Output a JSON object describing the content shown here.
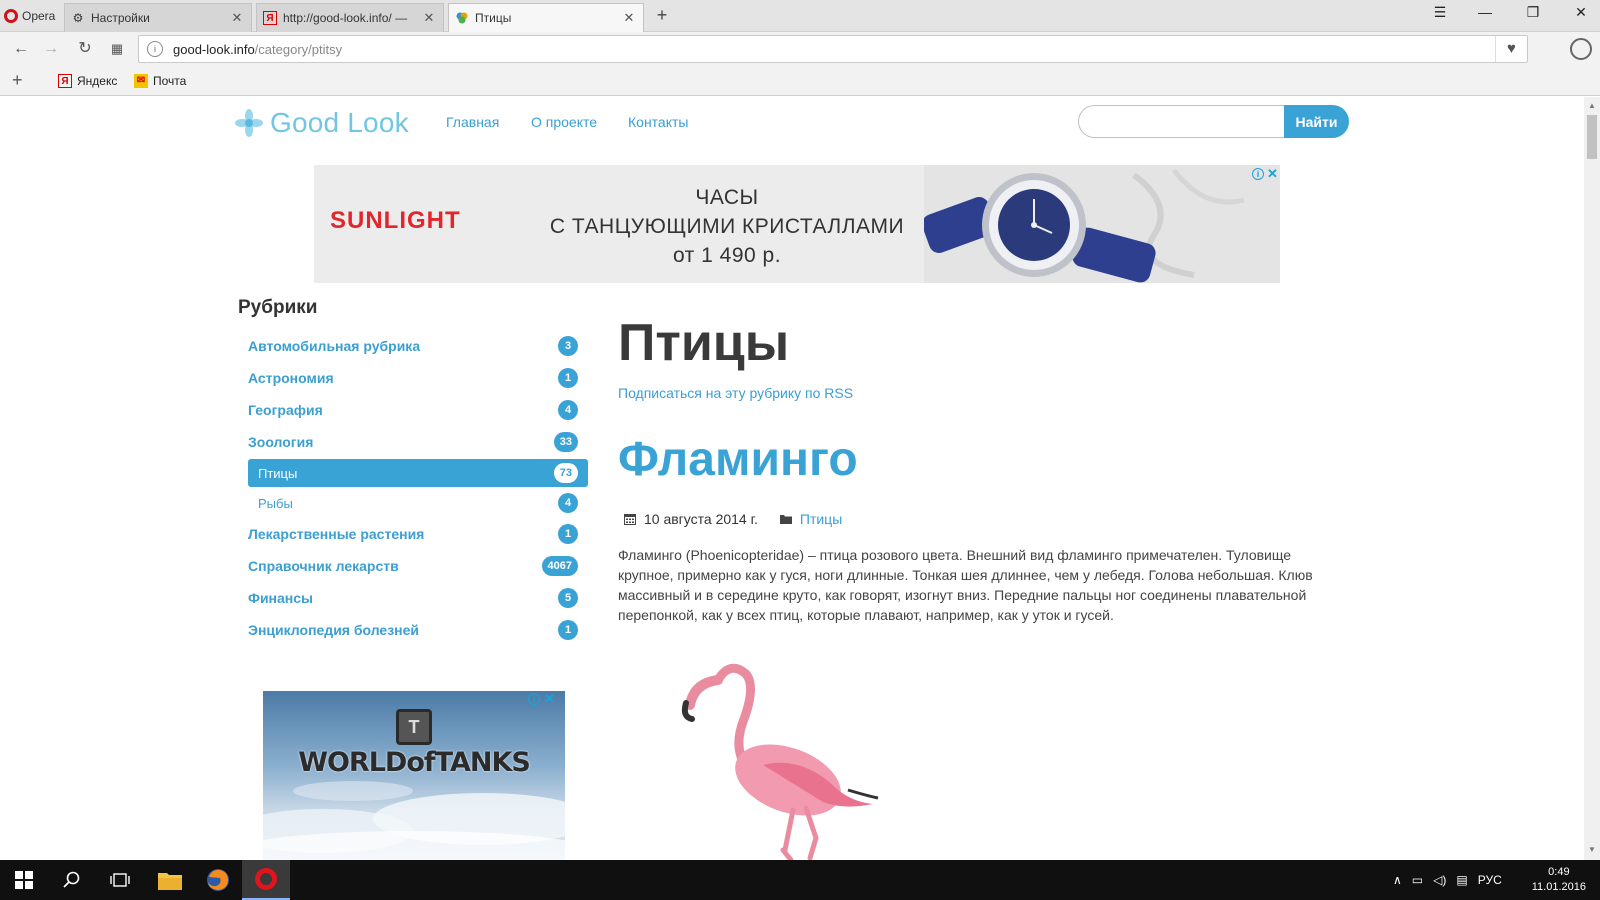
{
  "browser": {
    "menu_label": "Opera",
    "tabs": [
      {
        "label": "Настройки",
        "icon": "gear-icon"
      },
      {
        "label": "http://good-look.info/ — ",
        "icon": "yandex-icon"
      },
      {
        "label": "Птицы",
        "icon": "site-favicon"
      }
    ],
    "address": {
      "host": "good-look.info",
      "path": "/category/ptitsy"
    },
    "bookmarks": [
      {
        "label": "Яндекс",
        "icon": "yandex-icon"
      },
      {
        "label": "Почта",
        "icon": "mail-icon"
      }
    ]
  },
  "site": {
    "logo_text": "Good Look",
    "nav": [
      "Главная",
      "О проекте",
      "Контакты"
    ],
    "search": {
      "placeholder": "",
      "button": "Найти"
    }
  },
  "banner": {
    "brand": "SUNLIGHT",
    "line1": "ЧАСЫ",
    "line2": "С ТАНЦУЮЩИМИ КРИСТАЛЛАМИ",
    "line3": "от 1 490 р."
  },
  "sidebar": {
    "title": "Рубрики",
    "categories": [
      {
        "label": "Автомобильная рубрика",
        "count": "3"
      },
      {
        "label": "Астрономия",
        "count": "1"
      },
      {
        "label": "География",
        "count": "4"
      },
      {
        "label": "Зоология",
        "count": "33"
      },
      {
        "label": "Птицы",
        "count": "73"
      },
      {
        "label": "Рыбы",
        "count": "4"
      },
      {
        "label": "Лекарственные растения",
        "count": "1"
      },
      {
        "label": "Справочник лекарств",
        "count": "4067"
      },
      {
        "label": "Финансы",
        "count": "5"
      },
      {
        "label": "Энциклопедия болезней",
        "count": "1"
      }
    ]
  },
  "side_ad": {
    "brand": "WORLDofTANKS"
  },
  "main": {
    "page_title": "Птицы",
    "rss_link": "Подписаться на эту рубрику по RSS",
    "post": {
      "title": "Фламинго",
      "date": "10 августа 2014 г.",
      "category": "Птицы",
      "excerpt": "Фламинго (Phoenicopteridae) – птица розового цвета. Внешний вид фламинго примечателен. Туловище крупное, примерно как у гуся, ноги длинные. Тонкая шея длиннее, чем у лебедя. Голова небольшая. Клюв массивный и в середине круто, как говорят, изогнут вниз. Передние пальцы ног соединены плавательной перепонкой, как у всех птиц, которые плавают, например, как у уток и гусей."
    }
  },
  "taskbar": {
    "language": "РУС",
    "time": "0:49",
    "date": "11.01.2016"
  },
  "colors": {
    "accent": "#3aa3d6",
    "logo": "#71c6e3",
    "opera_red": "#d0121b"
  }
}
